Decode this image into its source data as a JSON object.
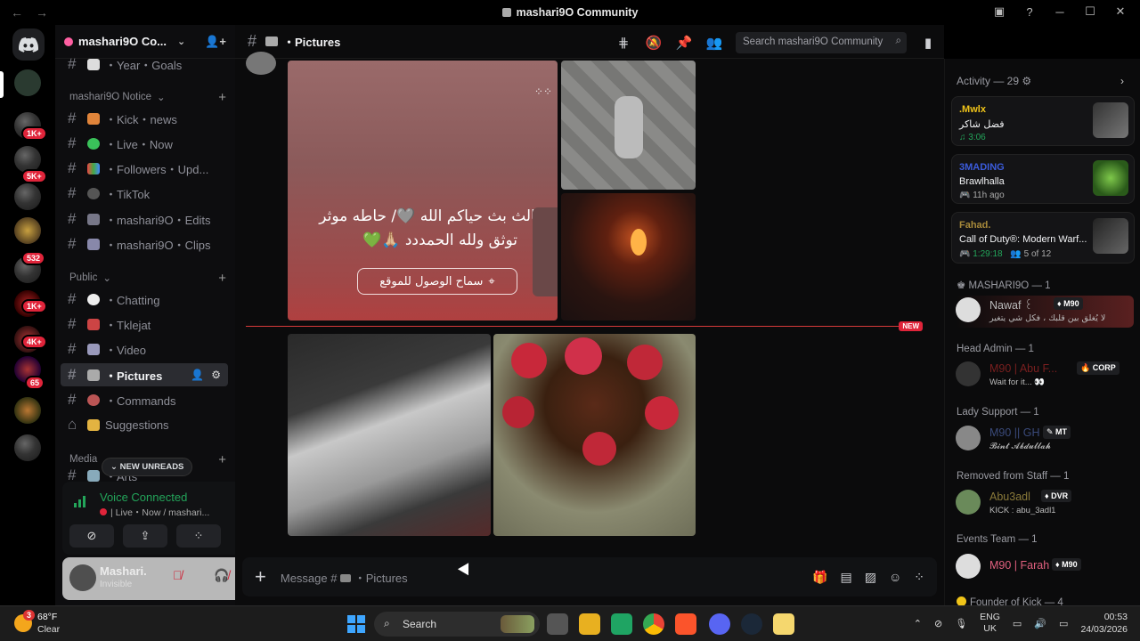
{
  "window": {
    "title": "mashari9O Community"
  },
  "server_rail": {
    "badges": [
      "1K+",
      "5K+",
      "532",
      "1K+",
      "4K+",
      "65"
    ]
  },
  "server": {
    "name": "mashari9O Co..."
  },
  "channels": {
    "top_item": "・Year・Goals",
    "categories": [
      {
        "label": "mashari9O Notice"
      },
      {
        "label": "Public"
      },
      {
        "label": "Media"
      }
    ],
    "notice": [
      {
        "label": "・Kick・news"
      },
      {
        "label": "・Live・Now"
      },
      {
        "label": "・Followers・Upd..."
      },
      {
        "label": "・TikTok"
      },
      {
        "label": "・mashari9O・Edits"
      },
      {
        "label": "・mashari9O・Clips"
      }
    ],
    "public": [
      {
        "label": "・Chatting"
      },
      {
        "label": "・Tklejat"
      },
      {
        "label": "・Video"
      },
      {
        "label": "・Pictures"
      },
      {
        "label": "・Commands"
      },
      {
        "label": "Suggestions"
      }
    ],
    "media_item": "・Arts",
    "new_unreads": "NEW UNREADS"
  },
  "voice": {
    "status": "Voice Connected",
    "channel": "| Live・Now / mashari..."
  },
  "user": {
    "name": "Mashari.",
    "status": "Invisible"
  },
  "header": {
    "channel_name": "・Pictures",
    "search_placeholder": "Search mashari9O Community"
  },
  "messages": {
    "arabic_line1": "ثالث بث حياكم الله 🩶/ حاطه موثر",
    "arabic_line2": "توثق ولله الحمددد 🙏🏼💚",
    "arabic_button": "سماح الوصول للموقع",
    "new_tag": "NEW"
  },
  "composer": {
    "placeholder": "Message #",
    "channel": "・Pictures"
  },
  "activity": {
    "header": "Activity — 29",
    "cards": [
      {
        "name": ".Mwlx",
        "title": "فضل شاكر",
        "sub": "3:06",
        "name_color": "#f0c419",
        "sub_color": "#23a55a"
      },
      {
        "name": "3MADING",
        "title": "Brawlhalla",
        "sub": "11h ago",
        "name_color": "#3b5bdb",
        "sub_color": "#aaaaaa"
      },
      {
        "name": "Fahad.",
        "title": "Call of Duty®: Modern Warf...",
        "sub": "1:29:18",
        "sub2": "5 of 12",
        "name_color": "#a88a3a",
        "sub_color": "#23a55a"
      }
    ]
  },
  "member_groups": [
    {
      "label": "MASHARI9O — 1",
      "members": [
        {
          "name": "Nawaf ꒰",
          "tag": "M90",
          "sub": "ﻻ ﻳُﻐﻠﻖ ﺑﻴﻦ ﻗﻠﺒﻚ ، ﻓﻜﻞ ﺷﻲ ﻳﺘﻐﻴﺮ",
          "color": "#bbbbbb"
        }
      ]
    },
    {
      "label": "Head Admin — 1",
      "members": [
        {
          "name": "M90 | Abu F...",
          "tag": "CORP",
          "sub": "Wait for it... 👀",
          "color": "#7a1f1f"
        }
      ]
    },
    {
      "label": "Lady Support — 1",
      "members": [
        {
          "name": "M90 || GH",
          "tag": "MT",
          "sub": "𝓑𝓲𝓷𝓽 𝓐𝓫𝓭𝓾𝓵𝓵𝓪𝓱",
          "color": "#3a4a7a"
        }
      ]
    },
    {
      "label": "Removed from Staff — 1",
      "members": [
        {
          "name": "Abu3adl",
          "tag": "DVR",
          "sub": "KICK : abu_3adl1",
          "color": "#8a7a3a"
        }
      ]
    },
    {
      "label": "Events Team — 1",
      "members": [
        {
          "name": "M90 | Farah",
          "tag": "M90",
          "sub": "",
          "color": "#e0607e"
        }
      ]
    },
    {
      "label": "Founder of Kick — 4",
      "members": []
    }
  ],
  "taskbar": {
    "temperature": "68°F",
    "condition": "Clear",
    "search_label": "Search",
    "lang1": "ENG",
    "lang2": "UK",
    "time": "00:53",
    "date": "24/03/2026",
    "notif_badge": "3"
  },
  "colors": {
    "accent_green": "#23a55a",
    "badge_red": "#e0243a",
    "win_blue": "#3ea6ff"
  }
}
